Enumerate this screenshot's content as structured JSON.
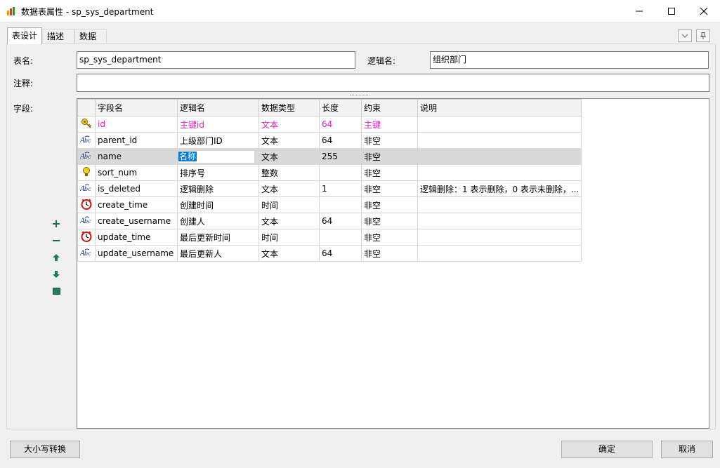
{
  "window": {
    "title": "数据表属性 - sp_sys_department"
  },
  "tabs": [
    {
      "label": "表设计"
    },
    {
      "label": "描述"
    },
    {
      "label": "数据"
    }
  ],
  "form": {
    "table_name_label": "表名:",
    "table_name_value": "sp_sys_department",
    "logic_name_label": "逻辑名:",
    "logic_name_value": "组织部门",
    "comment_label": "注释:",
    "comment_value": "",
    "fields_label": "字段:"
  },
  "grid": {
    "headers": [
      "字段名",
      "逻辑名",
      "数据类型",
      "长度",
      "约束",
      "说明"
    ],
    "rows": [
      {
        "icon": "key-icon",
        "name": "id",
        "logic": "主键id",
        "type": "文本",
        "length": "64",
        "constraint": "主键",
        "desc": ""
      },
      {
        "icon": "text-type-icon",
        "name": "parent_id",
        "logic": "上级部门ID",
        "type": "文本",
        "length": "64",
        "constraint": "非空",
        "desc": ""
      },
      {
        "icon": "text-type-icon",
        "name": "name",
        "logic": "名称",
        "type": "文本",
        "length": "255",
        "constraint": "非空",
        "desc": ""
      },
      {
        "icon": "bulb-icon",
        "name": "sort_num",
        "logic": "排序号",
        "type": "整数",
        "length": "",
        "constraint": "非空",
        "desc": ""
      },
      {
        "icon": "text-type-icon",
        "name": "is_deleted",
        "logic": "逻辑删除",
        "type": "文本",
        "length": "1",
        "constraint": "非空",
        "desc": "逻辑删除：1 表示删除，0 表示未删除，..."
      },
      {
        "icon": "clock-icon",
        "name": "create_time",
        "logic": "创建时间",
        "type": "时间",
        "length": "",
        "constraint": "非空",
        "desc": ""
      },
      {
        "icon": "text-type-icon",
        "name": "create_username",
        "logic": "创建人",
        "type": "文本",
        "length": "64",
        "constraint": "非空",
        "desc": ""
      },
      {
        "icon": "clock-icon",
        "name": "update_time",
        "logic": "最后更新时间",
        "type": "时间",
        "length": "",
        "constraint": "非空",
        "desc": ""
      },
      {
        "icon": "text-type-icon",
        "name": "update_username",
        "logic": "最后更新人",
        "type": "文本",
        "length": "64",
        "constraint": "非空",
        "desc": ""
      }
    ]
  },
  "buttons": {
    "case_convert": "大小写转换",
    "ok": "确定",
    "cancel": "取消"
  },
  "colors": {
    "primary_key_text": "#e020c8",
    "selection": "#0078d7"
  }
}
